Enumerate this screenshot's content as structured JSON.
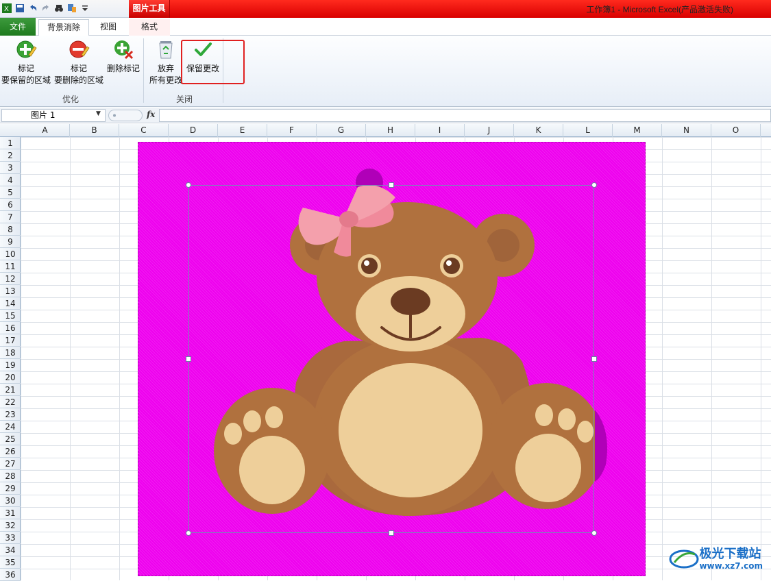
{
  "window": {
    "title": "工作簿1 - Microsoft Excel(产品激活失败)",
    "contextual_tab": "图片工具"
  },
  "tabs": {
    "file": "文件",
    "background_removal": "背景消除",
    "view": "视图",
    "format": "格式"
  },
  "ribbon": {
    "mark_keep": {
      "line1": "标记",
      "line2": "要保留的区域"
    },
    "mark_remove": {
      "line1": "标记",
      "line2": "要删除的区域"
    },
    "delete_mark": {
      "line1": "删除标记"
    },
    "discard": {
      "line1": "放弃",
      "line2": "所有更改"
    },
    "keep_changes": {
      "line1": "保留更改"
    },
    "group_optimize": "优化",
    "group_close": "关闭"
  },
  "formula_bar": {
    "name_box": "图片 1",
    "fx": "fx",
    "formula": ""
  },
  "columns": [
    "A",
    "B",
    "C",
    "D",
    "E",
    "F",
    "G",
    "H",
    "I",
    "J",
    "K",
    "L",
    "M",
    "N",
    "O"
  ],
  "rows": [
    "1",
    "2",
    "3",
    "4",
    "5",
    "6",
    "7",
    "8",
    "9",
    "10",
    "11",
    "12",
    "13",
    "14",
    "15",
    "16",
    "17",
    "18",
    "19",
    "20",
    "21",
    "22",
    "23",
    "24",
    "25",
    "26",
    "27",
    "28",
    "29",
    "30",
    "31",
    "32",
    "33",
    "34",
    "35",
    "36"
  ],
  "watermark": {
    "name": "极光下载站",
    "url": "www.xz7.com"
  },
  "colors": {
    "removal_magenta": "#ee00ee",
    "highlight_red": "#e02020",
    "file_tab_green": "#2a8a2a"
  }
}
